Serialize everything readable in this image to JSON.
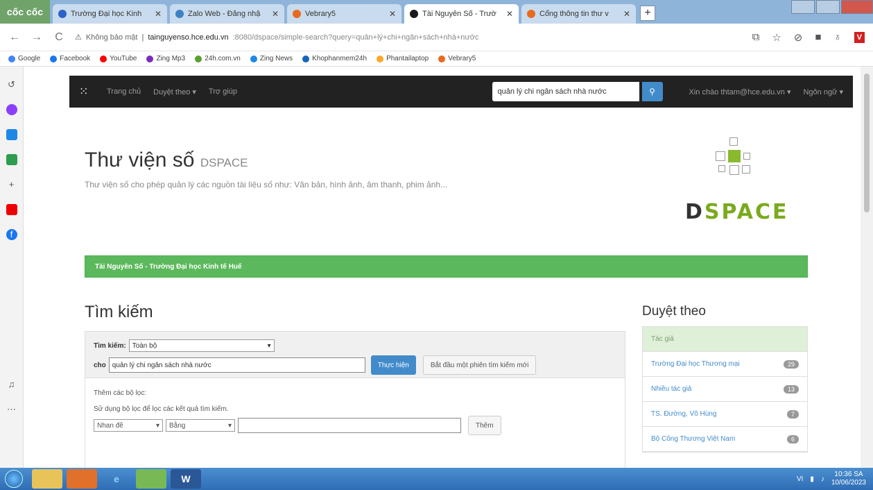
{
  "browser": {
    "logo": "cốc cốc",
    "tabs": [
      {
        "title": "Trường Đại học Kinh",
        "color": "#2a62c9",
        "active": false
      },
      {
        "title": "Zalo Web - Đăng nhậ",
        "color": "#3b82c4",
        "active": false
      },
      {
        "title": "Vebrary5",
        "color": "#e86a1e",
        "active": false
      },
      {
        "title": "Tài Nguyên Số - Trườ",
        "color": "#1a1a1a",
        "active": true
      },
      {
        "title": "Cổng thông tin thư v",
        "color": "#e86a1e",
        "active": false
      }
    ],
    "new_tab": "+",
    "address": {
      "secure_label": "Không bảo mật",
      "host": "tainguyenso.hce.edu.vn",
      "path": ":8080/dspace/simple-search?query=quản+lý+chi+ngân+sách+nhà+nước"
    },
    "bookmarks": [
      {
        "label": "Google",
        "color": "#4285f4"
      },
      {
        "label": "Facebook",
        "color": "#1877f2"
      },
      {
        "label": "YouTube",
        "color": "#ff0000"
      },
      {
        "label": "Zing Mp3",
        "color": "#7b2cbf"
      },
      {
        "label": "24h.com.vn",
        "color": "#5aa02c"
      },
      {
        "label": "Zing News",
        "color": "#1e88e5"
      },
      {
        "label": "Khophanmem24h",
        "color": "#1565c0"
      },
      {
        "label": "Phantailaptop",
        "color": "#ffa726"
      },
      {
        "label": "Vebrary5",
        "color": "#e86a1e"
      }
    ]
  },
  "site": {
    "nav": {
      "home": "Trang chủ",
      "browse": "Duyệt theo ▾",
      "help": "Trợ giúp",
      "search_value": "quản lý chi ngân sách nhà nước",
      "user": "Xin chào thtam@hce.edu.vn ▾",
      "language": "Ngôn ngữ ▾"
    },
    "title": "Thư viện số",
    "title_small": "DSPACE",
    "subtitle": "Thư viện số cho phép quản lý các nguồn tài liệu số như: Văn bản, hình ảnh, âm thanh, phim ảnh...",
    "logo_text_d": "D",
    "logo_text_rest": "SPACE",
    "breadcrumb": "Tài Nguyên Số - Trường Đại học Kinh tế Huế"
  },
  "search": {
    "heading": "Tìm kiếm",
    "scope_label": "Tìm kiếm:",
    "scope_value": "Toàn bộ",
    "for_label": "cho",
    "query": "quản lý chi ngân sách nhà nước",
    "run_button": "Thực hiện",
    "new_search_button": "Bắt đầu một phiên tìm kiếm mới",
    "filters_title": "Thêm các bộ lọc:",
    "filters_help": "Sử dụng bộ lọc để lọc các kết quả tìm kiếm.",
    "filter_field": "Nhan đề",
    "filter_op": "Bằng",
    "filter_value": "",
    "add_button": "Thêm"
  },
  "browse": {
    "heading": "Duyệt theo",
    "section": "Tác giả",
    "items": [
      {
        "label": "Trường Đại học Thương mại",
        "count": "29"
      },
      {
        "label": "Nhiều tác giả",
        "count": "13"
      },
      {
        "label": "TS. Đường, Võ Hùng",
        "count": "7"
      },
      {
        "label": "Bộ Công Thương Việt Nam",
        "count": "6"
      }
    ]
  },
  "taskbar": {
    "time": "10:36 SA",
    "date": "10/06/2023",
    "lang": "VI"
  },
  "colors": {
    "accent": "#428bca",
    "green": "#5cb85c",
    "dspace_green": "#8ab92d"
  }
}
